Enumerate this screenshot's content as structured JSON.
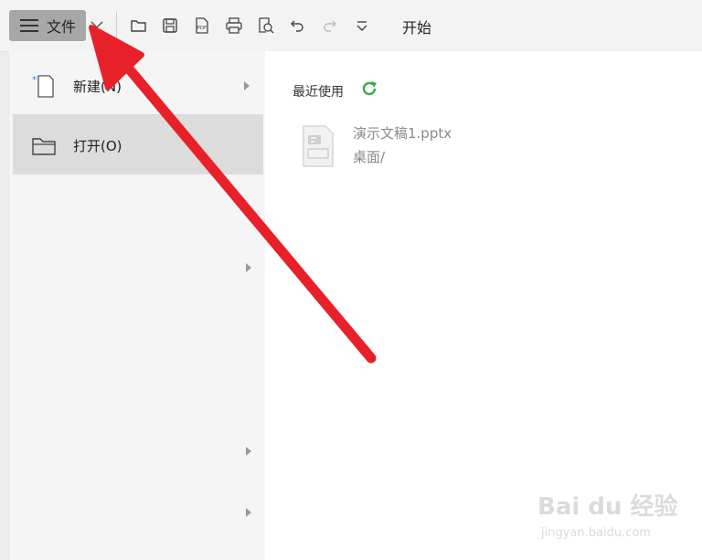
{
  "toolbar": {
    "file_label": "文件",
    "start_tab": "开始",
    "icons": [
      "open-folder-icon",
      "save-icon",
      "export-pdf-icon",
      "print-icon",
      "print-preview-icon",
      "undo-icon",
      "redo-icon",
      "more-icon"
    ]
  },
  "menu": {
    "items": [
      {
        "label": "新建(N)",
        "icon": "new-doc-icon",
        "has_submenu": true
      },
      {
        "label": "打开(O)",
        "icon": "folder-icon",
        "has_submenu": false,
        "selected": true
      }
    ]
  },
  "recent": {
    "title": "最近使用",
    "files": [
      {
        "name": "演示文稿1.pptx",
        "path": "桌面/"
      }
    ]
  },
  "colors": {
    "toolbar_bg": "#f3f3f3",
    "file_button_bg": "#a7a7a7",
    "menu_left_bg": "#f5f5f5",
    "selected_bg": "#dcdcdc",
    "refresh_green": "#3aa845",
    "annotation_red": "#e8202a"
  },
  "watermark": {
    "main": "Bai du 经验",
    "sub": "jingyan.baidu.com"
  }
}
